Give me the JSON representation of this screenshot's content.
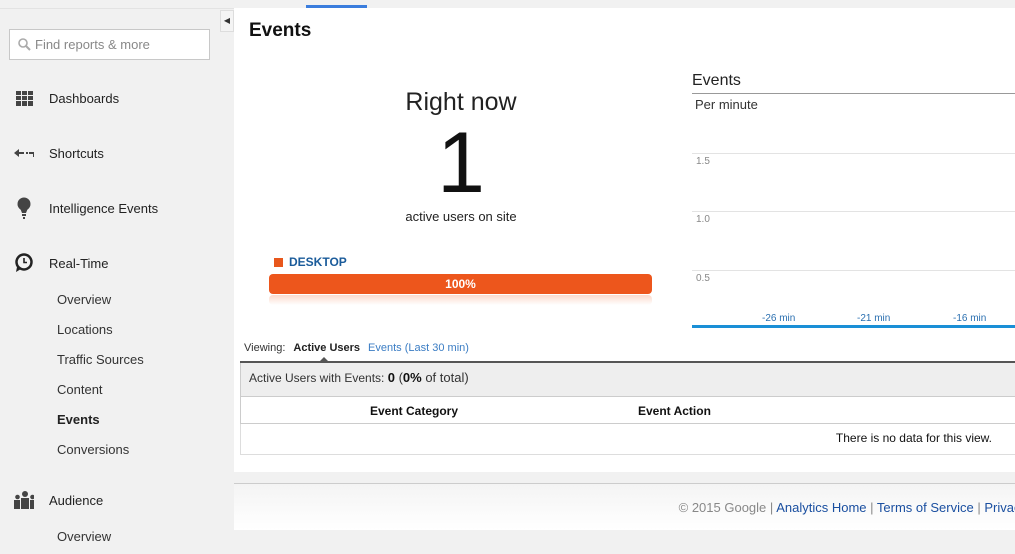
{
  "sidebar": {
    "collapse_icon": "triangle-left",
    "search_placeholder": "Find reports & more",
    "items": [
      {
        "label": "Dashboards",
        "icon": "grid-icon"
      },
      {
        "label": "Shortcuts",
        "icon": "arrow-left-icon"
      },
      {
        "label": "Intelligence Events",
        "icon": "lightbulb-icon"
      },
      {
        "label": "Real-Time",
        "icon": "clock-icon"
      },
      {
        "label": "Audience",
        "icon": "people-icon"
      }
    ],
    "realtime_sub": [
      "Overview",
      "Locations",
      "Traffic Sources",
      "Content",
      "Events",
      "Conversions"
    ],
    "realtime_active": "Events",
    "audience_sub": [
      "Overview"
    ]
  },
  "page": {
    "title": "Events"
  },
  "rightnow": {
    "heading": "Right now",
    "count": "1",
    "label": "active users on site",
    "device": "DESKTOP",
    "device_pct_label": "100%",
    "device_pct": 100,
    "device_color": "#ed561c"
  },
  "chart_data": {
    "type": "line",
    "title": "Events",
    "subtitle": "Per minute",
    "yticks": [
      "1.5",
      "1.0",
      "0.5"
    ],
    "ylim": [
      0,
      2
    ],
    "xticks": [
      "-26 min",
      "-21 min",
      "-16 min"
    ],
    "series": [],
    "grid": true,
    "line_color": "#1a8fd6"
  },
  "viewing": {
    "label": "Viewing:",
    "active_tab": "Active Users",
    "other_tab": "Events (Last 30 min)"
  },
  "table": {
    "summary_label": "Active Users with Events:",
    "summary_value": "0",
    "summary_open": " (",
    "summary_pct": "0%",
    "summary_rest": " of total)",
    "columns": [
      "Event Category",
      "Event Action"
    ],
    "empty": "There is no data for this view."
  },
  "footer": {
    "copyright": "© 2015 Google",
    "links": [
      "Analytics Home",
      "Terms of Service",
      "Privacy"
    ]
  }
}
